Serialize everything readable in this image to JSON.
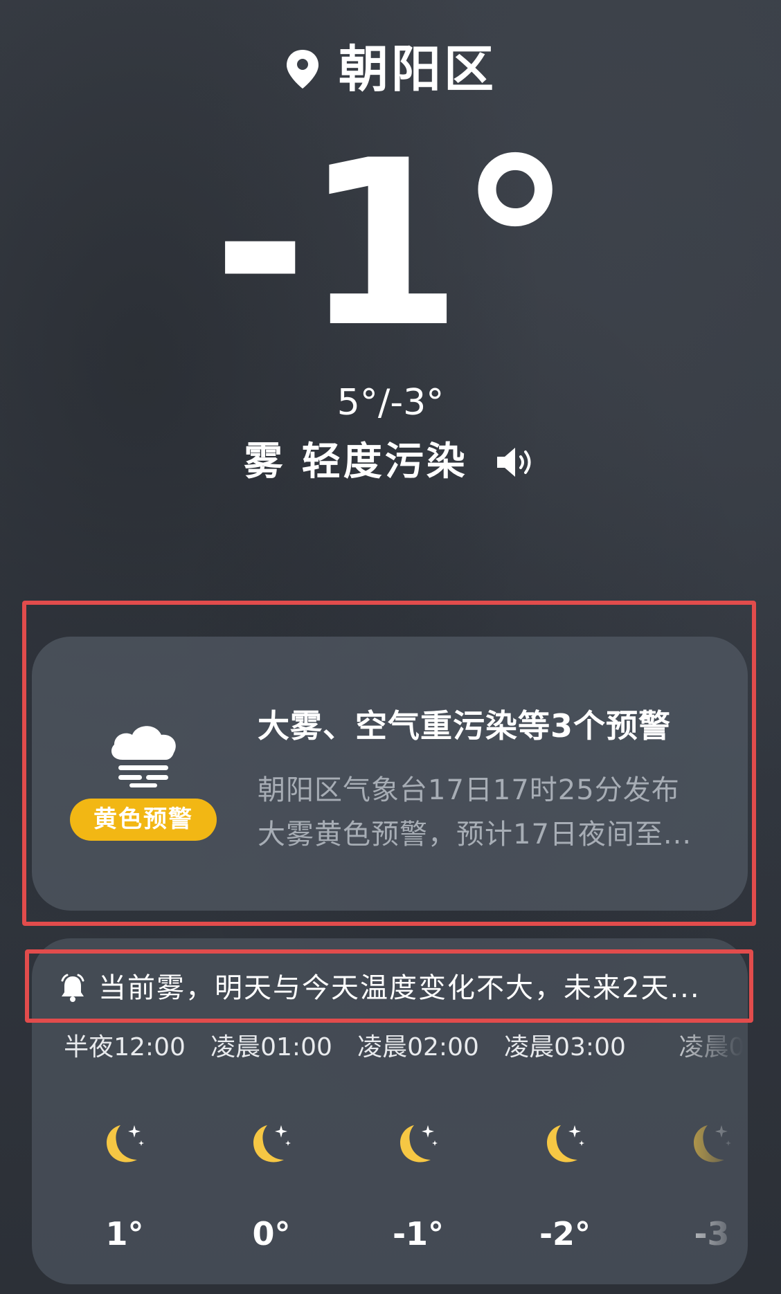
{
  "location": {
    "name": "朝阳区",
    "icon": "location-pin-icon"
  },
  "current": {
    "temperature": "-1°",
    "range": "5°/-3°",
    "condition": "雾 轻度污染",
    "speaker_icon": "speaker-icon"
  },
  "alert": {
    "icon": "fog-icon",
    "level": "黄色预警",
    "title": "大雾、空气重污染等3个预警",
    "desc_line1": "朝阳区气象台17日17时25分发布",
    "desc_line2": "大雾黄色预警，预计17日夜间至..."
  },
  "summary": {
    "icon": "bell-icon",
    "text": "当前雾，明天与今天温度变化不大，未来2天..."
  },
  "hourly": [
    {
      "time": "半夜12:00",
      "temp": "1°",
      "icon": "moon-icon"
    },
    {
      "time": "凌晨01:00",
      "temp": "0°",
      "icon": "moon-icon"
    },
    {
      "time": "凌晨02:00",
      "temp": "-1°",
      "icon": "moon-icon"
    },
    {
      "time": "凌晨03:00",
      "temp": "-2°",
      "icon": "moon-icon"
    },
    {
      "time": "凌晨0",
      "temp": "-3",
      "icon": "moon-icon"
    }
  ],
  "colors": {
    "badge_yellow": "#f2b714",
    "moon_yellow": "#f6c744",
    "highlight_red": "#e24c4c"
  }
}
